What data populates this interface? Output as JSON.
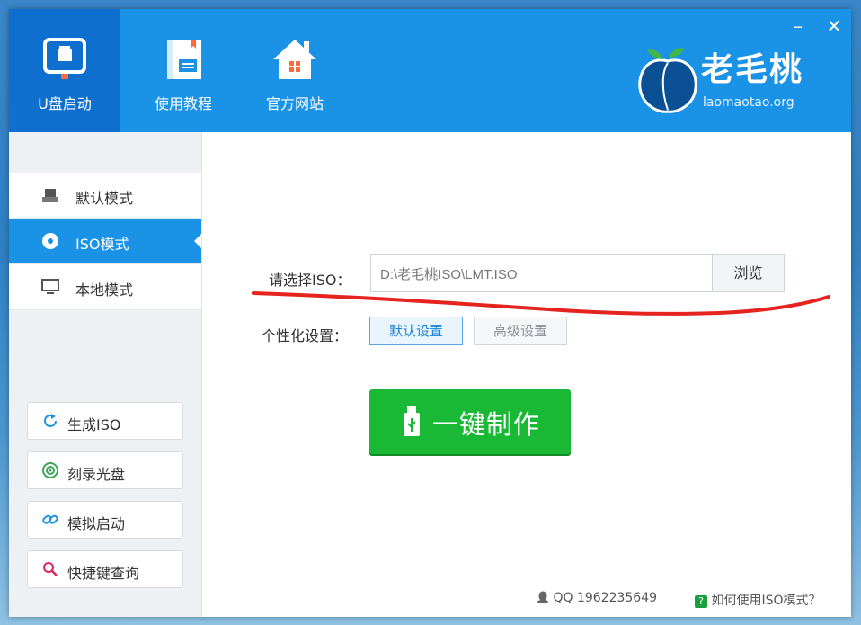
{
  "nav": {
    "items": [
      {
        "label": "U盘启动",
        "icon": "usb-drive-icon",
        "active": true
      },
      {
        "label": "使用教程",
        "icon": "tutorial-book-icon",
        "active": false
      },
      {
        "label": "官方网站",
        "icon": "home-icon",
        "active": false
      }
    ]
  },
  "window_controls": {
    "minimize": "–",
    "close": "✕"
  },
  "logo": {
    "name": "老毛桃",
    "url": "laomaotao.org"
  },
  "modes": [
    {
      "label": "默认模式",
      "icon": "usb-icon",
      "active": false
    },
    {
      "label": "ISO模式",
      "icon": "disc-icon",
      "active": true
    },
    {
      "label": "本地模式",
      "icon": "monitor-icon",
      "active": false
    }
  ],
  "tools": [
    {
      "label": "生成ISO",
      "icon": "refresh-icon"
    },
    {
      "label": "刻录光盘",
      "icon": "burn-disc-icon"
    },
    {
      "label": "模拟启动",
      "icon": "link-icon"
    },
    {
      "label": "快捷键查询",
      "icon": "search-icon"
    }
  ],
  "main": {
    "iso_label": "请选择ISO：",
    "iso_path": "D:\\老毛桃ISO\\LMT.ISO",
    "browse_label": "浏览",
    "personal_label": "个性化设置：",
    "default_settings_label": "默认设置",
    "advanced_settings_label": "高级设置",
    "make_label": "一键制作"
  },
  "footer": {
    "qq": "QQ 1962235649",
    "help": "如何使用ISO模式？",
    "help_badge": "?"
  },
  "colors": {
    "header_blue": "#1a93e6",
    "active_nav": "#0f6fcf",
    "make_green": "#19b935",
    "annotation_red": "#e52420"
  }
}
